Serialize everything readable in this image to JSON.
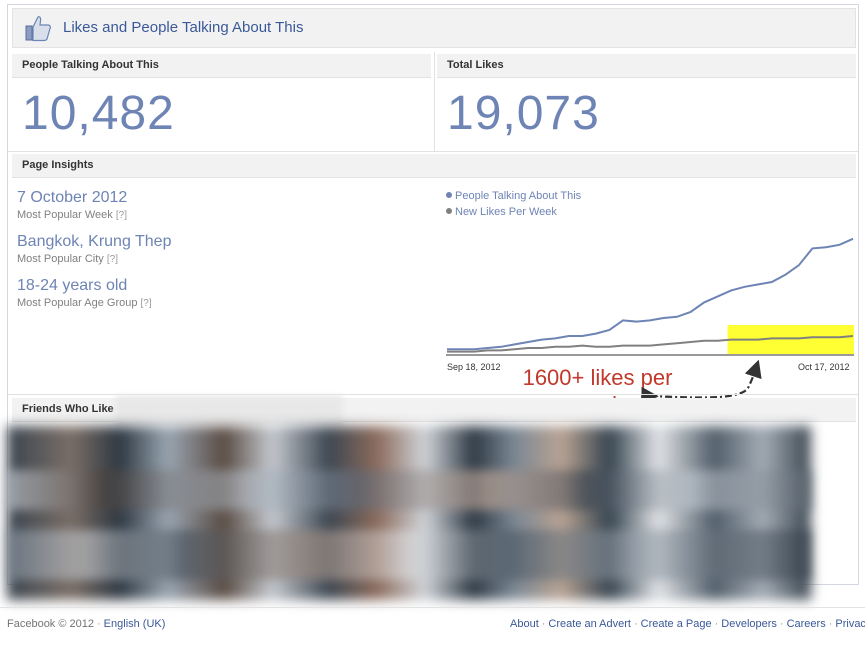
{
  "header": {
    "title": "Likes and People Talking About This",
    "icon": "thumbs-up-icon"
  },
  "stats": {
    "talking": {
      "label": "People Talking About This",
      "value": "10,482"
    },
    "likes": {
      "label": "Total Likes",
      "value": "19,073"
    }
  },
  "insights": {
    "title": "Page Insights",
    "items": [
      {
        "value": "7 October 2012",
        "label": "Most Popular Week",
        "help": "[?]"
      },
      {
        "value": "Bangkok, Krung Thep",
        "label": "Most Popular City",
        "help": "[?]"
      },
      {
        "value": "18-24 years old",
        "label": "Most Popular Age Group",
        "help": "[?]"
      }
    ]
  },
  "chart_data": {
    "type": "line",
    "x_labels": [
      "Sep 18, 2012",
      "Oct 17, 2012"
    ],
    "series": [
      {
        "name": "People Talking About This",
        "color": "#6d84b4",
        "values": [
          0.04,
          0.04,
          0.04,
          0.05,
          0.06,
          0.08,
          0.1,
          0.12,
          0.13,
          0.15,
          0.15,
          0.17,
          0.2,
          0.28,
          0.27,
          0.28,
          0.3,
          0.31,
          0.35,
          0.43,
          0.48,
          0.53,
          0.56,
          0.58,
          0.6,
          0.66,
          0.74,
          0.88,
          0.89,
          0.91,
          0.96
        ]
      },
      {
        "name": "New Likes Per Week",
        "color": "#808080",
        "values": [
          0.02,
          0.02,
          0.02,
          0.03,
          0.03,
          0.04,
          0.05,
          0.05,
          0.06,
          0.06,
          0.07,
          0.06,
          0.06,
          0.07,
          0.07,
          0.07,
          0.08,
          0.09,
          0.1,
          0.11,
          0.11,
          0.12,
          0.12,
          0.12,
          0.13,
          0.13,
          0.13,
          0.14,
          0.14,
          0.14,
          0.15
        ]
      }
    ],
    "highlight_color": "#ffff33",
    "highlight_start_fraction": 0.69
  },
  "annotation": {
    "line1": "1600+ likes per",
    "line2": "week"
  },
  "friends": {
    "title": "Friends Who Like"
  },
  "footer": {
    "copyright": "Facebook © 2012",
    "language": "English (UK)",
    "links": [
      "About",
      "Create an Advert",
      "Create a Page",
      "Developers",
      "Careers",
      "Privac"
    ]
  }
}
